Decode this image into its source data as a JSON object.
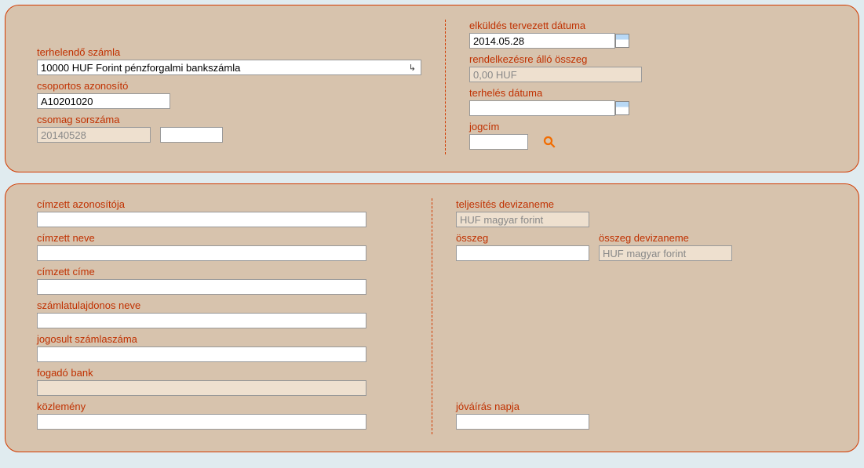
{
  "top": {
    "left": {
      "account_label": "terhelendő számla",
      "account_value": "10000 HUF Forint pénzforgalmi bankszámla",
      "group_id_label": "csoportos azonosító",
      "group_id_value": "A10201020",
      "package_no_label": "csomag sorszáma",
      "package_no_value": "20140528",
      "package_suffix_value": ""
    },
    "right": {
      "send_date_label": "elküldés tervezett dátuma",
      "send_date_value": "2014.05.28",
      "avail_label": "rendelkezésre álló összeg",
      "avail_value": "0,00 HUF",
      "debit_date_label": "terhelés dátuma",
      "debit_date_value": "",
      "title_code_label": "jogcím",
      "title_code_value": ""
    }
  },
  "bottom": {
    "left": {
      "payee_id_label": "címzett azonosítója",
      "payee_id_value": "",
      "payee_name_label": "címzett neve",
      "payee_name_value": "",
      "payee_addr_label": "címzett címe",
      "payee_addr_value": "",
      "account_owner_label": "számlatulajdonos neve",
      "account_owner_value": "",
      "beneficiary_acct_label": "jogosult számlaszáma",
      "beneficiary_acct_value": "",
      "receiving_bank_label": "fogadó bank",
      "receiving_bank_value": "",
      "remittance_label": "közlemény",
      "remittance_value": ""
    },
    "right": {
      "perf_ccy_label": "teljesítés devizaneme",
      "perf_ccy_value": "HUF magyar forint",
      "amount_label": "összeg",
      "amount_value": "",
      "amount_ccy_label": "összeg devizaneme",
      "amount_ccy_value": "HUF magyar forint",
      "credit_date_label": "jóváírás napja",
      "credit_date_value": ""
    }
  }
}
